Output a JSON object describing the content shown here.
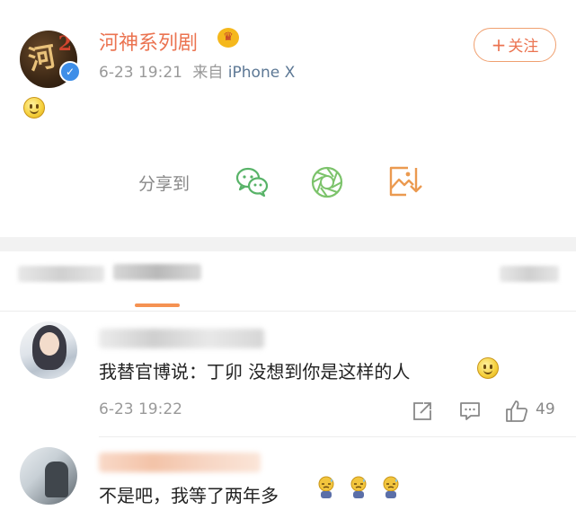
{
  "post": {
    "author_name": "河神系列剧",
    "timestamp": "6-23 19:21",
    "source_prefix": "来自",
    "source_device": "iPhone X",
    "follow_label": "关注",
    "follow_plus": "+",
    "avatar_glyph": "河",
    "avatar_num": "2",
    "vip_glyph": "♛",
    "verified_glyph": "✓"
  },
  "share": {
    "label": "分享到",
    "targets": [
      "wechat-icon",
      "moments-icon",
      "save-image-icon"
    ]
  },
  "tabs": {
    "active_indicator_color": "#f59252"
  },
  "comments": [
    {
      "text": "我替官博说：丁卯  没想到你是这样的人",
      "time": "6-23 19:22",
      "likes": "49",
      "emoji": "smile-emoji"
    },
    {
      "text": "不是吧，我等了两年多",
      "emoji": [
        "sad-sweat-emoji",
        "sad-sweat-emoji",
        "sad-sweat-emoji"
      ]
    }
  ],
  "colors": {
    "accent_orange": "#eb7350",
    "link_blue": "#5d7895",
    "meta_gray": "#999999",
    "verified_blue": "#3e8ee8"
  }
}
